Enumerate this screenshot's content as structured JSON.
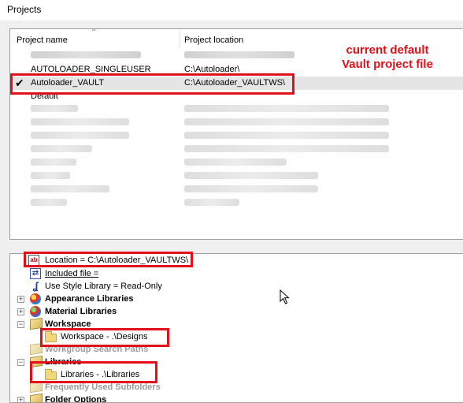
{
  "window": {
    "title": "Projects"
  },
  "projects_list": {
    "columns": {
      "name": "Project name",
      "location": "Project location"
    },
    "rows": [
      {
        "name": "",
        "location": "",
        "blurred": true,
        "selected": false
      },
      {
        "name": "AUTOLOADER_SINGLEUSER",
        "location": "C:\\Autoloader\\",
        "blurred": false,
        "selected": false
      },
      {
        "name": "Autoloader_VAULT",
        "location": "C:\\Autoloader_VAULTWS\\",
        "blurred": false,
        "selected": true
      },
      {
        "name": "Default",
        "location": "",
        "blurred": false,
        "selected": false
      },
      {
        "name": "",
        "location": "",
        "blurred": true,
        "selected": false
      },
      {
        "name": "",
        "location": "",
        "blurred": true,
        "selected": false
      },
      {
        "name": "",
        "location": "",
        "blurred": true,
        "selected": false
      },
      {
        "name": "",
        "location": "",
        "blurred": true,
        "selected": false
      },
      {
        "name": "",
        "location": "",
        "blurred": true,
        "selected": false
      },
      {
        "name": "",
        "location": "",
        "blurred": true,
        "selected": false
      },
      {
        "name": "",
        "location": "",
        "blurred": true,
        "selected": false
      },
      {
        "name": "",
        "location": "",
        "blurred": true,
        "selected": false
      }
    ]
  },
  "annotation": {
    "text": "current default Vault project file",
    "color": "#e2101a"
  },
  "settings_tree": {
    "location": "Location = C:\\Autoloader_VAULTWS\\",
    "included_file": "Included file =",
    "use_style_library": "Use Style Library = Read-Only",
    "appearance_libraries": "Appearance Libraries",
    "material_libraries": "Material Libraries",
    "workspace": "Workspace",
    "workspace_path": "Workspace - .\\Designs",
    "workgroup_search_paths": "Workgroup Search Paths",
    "libraries": "Libraries",
    "libraries_path": "Libraries - .\\Libraries",
    "frequently_used_subfolders": "Frequently Used Subfolders",
    "folder_options": "Folder Options"
  },
  "icons": {
    "check": "checkmark-icon",
    "location": "text-field-icon",
    "included_file": "link-icon",
    "style_library": "style-icon",
    "appearance": "appearance-sphere-icon",
    "material": "material-sphere-icon",
    "folder": "folder-icon"
  }
}
